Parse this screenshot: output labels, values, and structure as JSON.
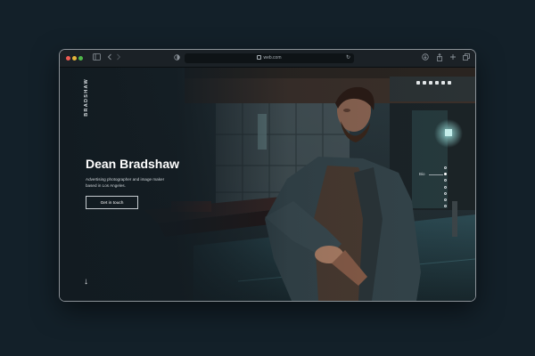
{
  "browser": {
    "url": "web.com"
  },
  "site": {
    "brand": "BRADSHAW",
    "hero": {
      "title": "Dean Bradshaw",
      "subtitle": "Advertising photographer and image maker based in Los Angeles.",
      "cta_label": "Get in touch"
    },
    "scroll_arrow": "↓",
    "socials": [
      "behance-icon",
      "instagram-icon",
      "twitter-icon",
      "facebook-icon",
      "pinterest-icon",
      "youtube-icon"
    ],
    "side_nav": {
      "label": "Bio",
      "pages": 7,
      "active_index": 1
    }
  },
  "colors": {
    "background": "#132029",
    "page": "#162027",
    "text": "#ffffff"
  }
}
